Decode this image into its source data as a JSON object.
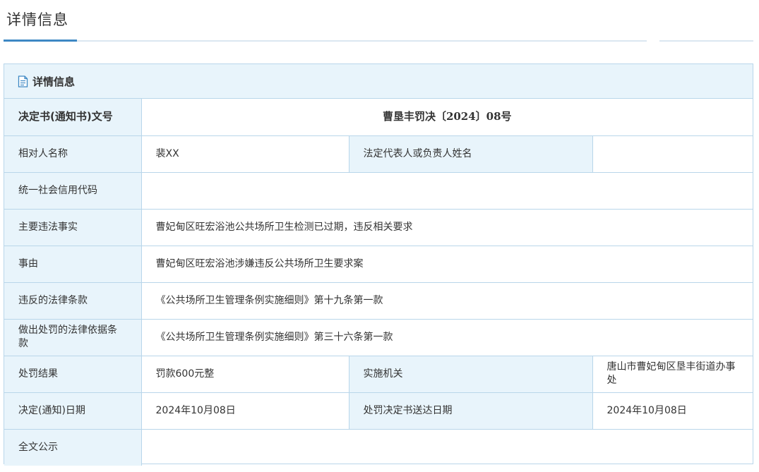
{
  "page": {
    "title": "详情信息"
  },
  "panel": {
    "header_label": "详情信息",
    "header_icon": "document-icon"
  },
  "rows": {
    "doc_no": {
      "label": "决定书(通知书)文号",
      "value": "曹垦丰罚决〔2024〕08号"
    },
    "party_name": {
      "label": "相对人名称",
      "value": "裴XX"
    },
    "legal_rep": {
      "label": "法定代表人或负责人姓名",
      "value": ""
    },
    "credit_code": {
      "label": "统一社会信用代码",
      "value": ""
    },
    "main_facts": {
      "label": "主要违法事实",
      "value": "曹妃甸区旺宏浴池公共场所卫生检测已过期，违反相关要求"
    },
    "cause": {
      "label": "事由",
      "value": "曹妃甸区旺宏浴池涉嫌违反公共场所卫生要求案"
    },
    "violated_law": {
      "label": "违反的法律条款",
      "value": "《公共场所卫生管理条例实施细则》第十九条第一款"
    },
    "penalty_basis": {
      "label": "做出处罚的法律依据条款",
      "value": "《公共场所卫生管理条例实施细则》第三十六条第一款"
    },
    "penalty_result": {
      "label": "处罚结果",
      "value": "罚款600元整"
    },
    "agency": {
      "label": "实施机关",
      "value": "唐山市曹妃甸区垦丰街道办事处"
    },
    "decision_date": {
      "label": "决定(通知)日期",
      "value": "2024年10月08日"
    },
    "delivery_date": {
      "label": "处罚决定书送达日期",
      "value": "2024年10月08日"
    },
    "full_text": {
      "label": "全文公示",
      "value": ""
    }
  },
  "colors": {
    "label_bg": "#e8f4fb",
    "border": "#b9d6ea",
    "accent": "#3d88c4"
  }
}
